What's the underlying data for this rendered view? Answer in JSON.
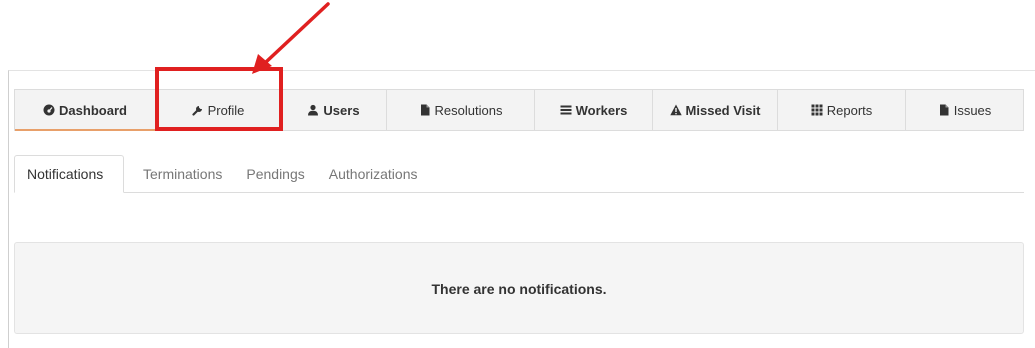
{
  "main_nav": [
    {
      "label": "Dashboard",
      "icon": "dashboard-icon",
      "active": true
    },
    {
      "label": "Profile",
      "icon": "wrench-icon",
      "active": false
    },
    {
      "label": "Users",
      "icon": "user-icon",
      "active": false
    },
    {
      "label": "Resolutions",
      "icon": "file-icon",
      "active": false
    },
    {
      "label": "Workers",
      "icon": "list-icon",
      "active": false
    },
    {
      "label": "Missed Visit",
      "icon": "warning-icon",
      "active": false
    },
    {
      "label": "Reports",
      "icon": "grid-icon",
      "active": false
    },
    {
      "label": "Issues",
      "icon": "file-icon",
      "active": false
    }
  ],
  "sub_tabs": [
    {
      "label": "Notifications",
      "active": true
    },
    {
      "label": "Terminations",
      "active": false
    },
    {
      "label": "Pendings",
      "active": false
    },
    {
      "label": "Authorizations",
      "active": false
    }
  ],
  "content": {
    "message": "There are no notifications."
  },
  "annotation": {
    "color": "#e02020"
  },
  "colors": {
    "active_underline": "#e8a06a"
  }
}
